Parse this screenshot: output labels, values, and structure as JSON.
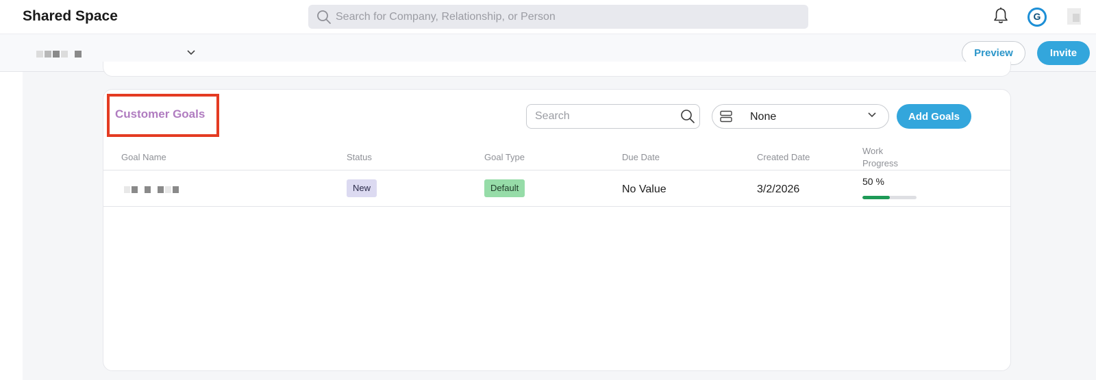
{
  "header": {
    "app_title": "Shared Space",
    "search_placeholder": "Search for Company, Relationship, or Person",
    "icons": [
      "search-icon",
      "bell-icon",
      "avatar-icon",
      "user-icon"
    ],
    "avatar_letter": "G"
  },
  "subheader": {
    "icons": [
      "chevron-down-icon"
    ],
    "preview_label": "Preview",
    "invite_label": "Invite"
  },
  "goals": {
    "title": "Customer Goals",
    "search_placeholder": "Search",
    "group_by_value": "None",
    "add_label": "Add Goals",
    "columns": [
      "Goal Name",
      "Status",
      "Goal Type",
      "Due Date",
      "Created Date",
      "Work Progress"
    ],
    "rows": [
      {
        "status": "New",
        "goal_type": "Default",
        "due_date": "No Value",
        "created_date": "3/2/2026",
        "progress_label": "50 %",
        "progress_value": 0.5
      }
    ]
  },
  "colors": {
    "accent": "#33a6dc",
    "title_purple": "#b07cc0",
    "highlight_red": "#e43b22",
    "status_new_bg": "#dcdaf1",
    "type_default_bg": "#96dca8",
    "progress_fill": "#1e9a57"
  }
}
